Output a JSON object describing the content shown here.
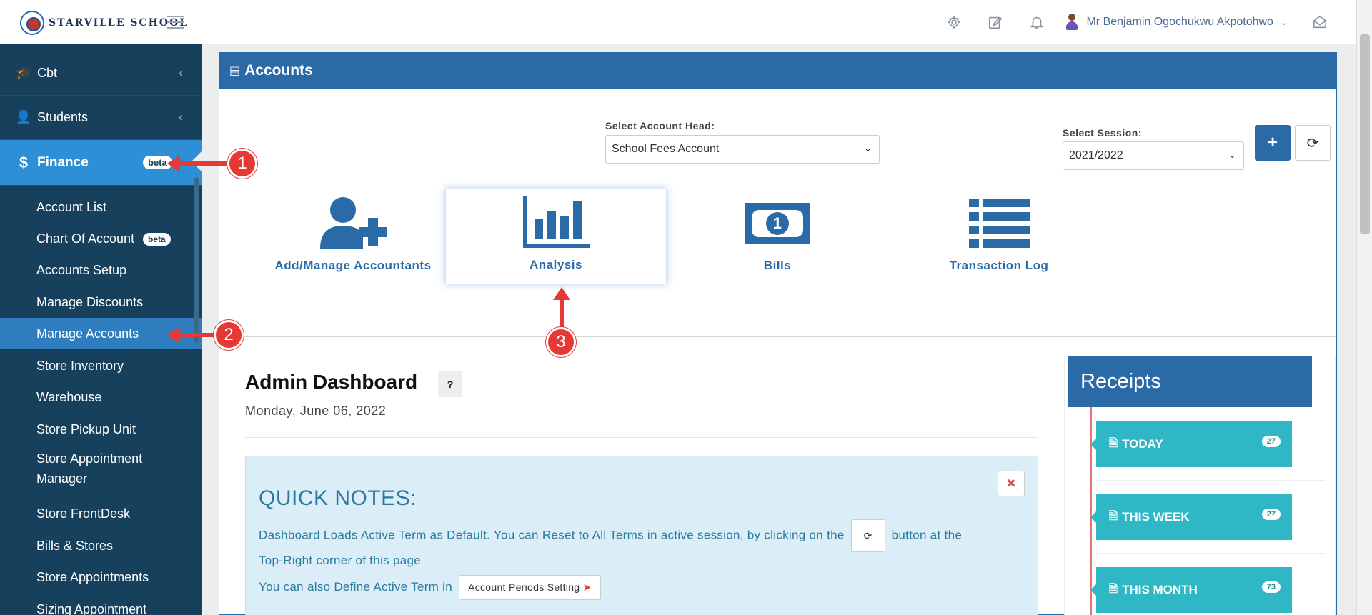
{
  "header": {
    "logo_text": "STARVILLE SCHOOL",
    "user_name": "Mr Benjamin Ogochukwu Akpotohwo"
  },
  "sidebar": {
    "cbt": "Cbt",
    "students": "Students",
    "finance": "Finance",
    "finance_badge": "beta",
    "items": [
      {
        "label": "Account List"
      },
      {
        "label": "Chart Of Account",
        "badge": "beta"
      },
      {
        "label": "Accounts Setup"
      },
      {
        "label": "Manage Discounts"
      },
      {
        "label": "Manage Accounts"
      },
      {
        "label": "Store Inventory"
      },
      {
        "label": "Warehouse"
      },
      {
        "label": "Store Pickup Unit"
      },
      {
        "label": "Store Appointment Manager"
      },
      {
        "label": "Store FrontDesk"
      },
      {
        "label": "Bills & Stores"
      },
      {
        "label": "Store Appointments"
      },
      {
        "label": "Sizing Appointment"
      }
    ]
  },
  "panel": {
    "title": "Accounts",
    "account_head_label": "Select Account Head:",
    "account_head_value": "School Fees Account",
    "session_label": "Select Session:",
    "session_value": "2021/2022",
    "add_label": "+",
    "tiles": [
      {
        "label": "Add/Manage Accountants"
      },
      {
        "label": "Analysis"
      },
      {
        "label": "Bills"
      },
      {
        "label": "Transaction Log"
      }
    ]
  },
  "dashboard": {
    "title": "Admin Dashboard",
    "help": "?",
    "date": "Monday, June 06, 2022",
    "notes": {
      "title": "QUICK NOTES:",
      "line1_a": "Dashboard Loads Active Term as Default. You can Reset to All Terms in active session, by clicking on the",
      "line1_b": "button at the",
      "line2": "Top-Right corner of this page",
      "line3": "You can also Define Active Term in",
      "button": "Account Periods Setting"
    }
  },
  "receipts": {
    "title": "Receipts",
    "items": [
      {
        "label": "TODAY",
        "count": "27"
      },
      {
        "label": "THIS WEEK",
        "count": "27"
      },
      {
        "label": "THIS MONTH",
        "count": "73"
      }
    ]
  },
  "annotations": [
    "1",
    "2",
    "3"
  ],
  "colors": {
    "sidebar_bg": "#16405c",
    "finance_active": "#2d8fd5",
    "primary": "#2a6aa7",
    "receipt_teal": "#2fb7c6",
    "annotation_red": "#e53935"
  }
}
